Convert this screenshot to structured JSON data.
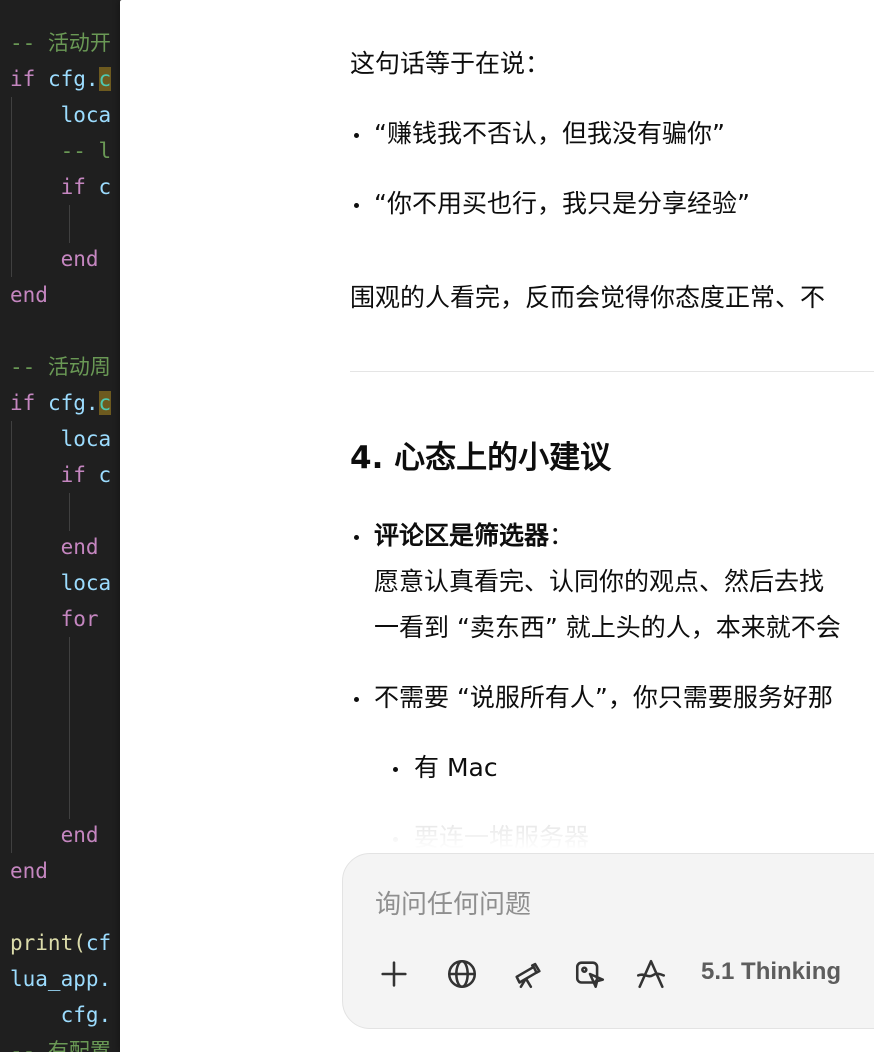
{
  "editor": {
    "lines": [
      {
        "text": "-- 活动开",
        "kind": "comment"
      },
      {
        "text": "if cfg.",
        "kind": "if-hl"
      },
      {
        "text": "    loca",
        "kind": "id"
      },
      {
        "text": "    -- l",
        "kind": "comment"
      },
      {
        "text": "    if c",
        "kind": "if"
      },
      {
        "text": "",
        "kind": "plain"
      },
      {
        "text": "    end",
        "kind": "kw"
      },
      {
        "text": "end",
        "kind": "kw"
      },
      {
        "text": "",
        "kind": "plain"
      },
      {
        "text": "-- 活动周",
        "kind": "comment"
      },
      {
        "text": "if cfg.",
        "kind": "if-hl"
      },
      {
        "text": "    loca",
        "kind": "id"
      },
      {
        "text": "    if c",
        "kind": "if"
      },
      {
        "text": "",
        "kind": "plain"
      },
      {
        "text": "    end",
        "kind": "kw"
      },
      {
        "text": "    loca",
        "kind": "id"
      },
      {
        "text": "    for",
        "kind": "kw"
      },
      {
        "text": "",
        "kind": "plain"
      },
      {
        "text": "",
        "kind": "plain"
      },
      {
        "text": "",
        "kind": "plain"
      },
      {
        "text": "",
        "kind": "plain"
      },
      {
        "text": "",
        "kind": "plain"
      },
      {
        "text": "    end",
        "kind": "kw"
      },
      {
        "text": "end",
        "kind": "kw"
      },
      {
        "text": "",
        "kind": "plain"
      },
      {
        "text": "print(cf",
        "kind": "fn"
      },
      {
        "text": "lua_app.",
        "kind": "id"
      },
      {
        "text": "    cfg.",
        "kind": "id"
      },
      {
        "text": "-- 有配置",
        "kind": "comment"
      }
    ]
  },
  "chat": {
    "intro": "这句话等于在说：",
    "quote1": "“赚钱我不否认，但我没有骗你”",
    "quote2": "“你不用买也行，我只是分享经验”",
    "observer": "围观的人看完，反而会觉得你态度正常、不",
    "section_heading": "4. 心态上的小建议",
    "tip1_title": "评论区是筛选器",
    "tip1_colon": "：",
    "tip1_line1": "愿意认真看完、认同你的观点、然后去找",
    "tip1_line2": "一看到 “卖东西” 就上头的人，本来就不会",
    "tip2": "不需要 “说服所有人”，你只需要服务好那",
    "sub1": "有 Mac",
    "sub2": "要连一堆服务器"
  },
  "composer": {
    "placeholder": "询问任何问题",
    "model_label": "5.1 Thinking",
    "tools": [
      "plus-icon",
      "globe-icon",
      "telescope-icon",
      "image-edit-icon",
      "canvas-pen-icon"
    ]
  },
  "colors": {
    "editor_bg": "#1f1f1f",
    "comment": "#6a9955",
    "keyword": "#c586c0",
    "identifier": "#9cdcfe",
    "function": "#dcdcaa",
    "composer_bg": "#f4f4f4"
  }
}
